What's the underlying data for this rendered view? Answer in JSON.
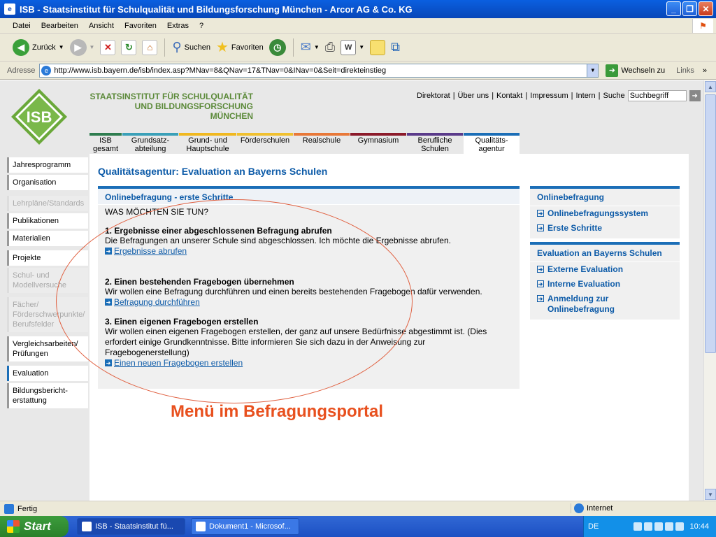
{
  "window": {
    "title": "ISB - Staatsinstitut für Schulqualität und Bildungsforschung München - Arcor AG & Co. KG"
  },
  "menu": [
    "Datei",
    "Bearbeiten",
    "Ansicht",
    "Favoriten",
    "Extras",
    "?"
  ],
  "toolbar": {
    "back": "Zurück",
    "search": "Suchen",
    "favorites": "Favoriten"
  },
  "address": {
    "label": "Adresse",
    "url": "http://www.isb.bayern.de/isb/index.asp?MNav=8&QNav=17&TNav=0&INav=0&Seit=direkteinstieg",
    "go": "Wechseln zu",
    "links": "Links"
  },
  "site": {
    "logo_text": "ISB",
    "org_line1": "STAATSINSTITUT FÜR SCHULQUALITÄT",
    "org_line2": "UND BILDUNGSFORSCHUNG",
    "org_line3": "MÜNCHEN",
    "topnav": [
      "Direktorat",
      "Über uns",
      "Kontakt",
      "Impressum",
      "Intern",
      "Suche"
    ],
    "search_placeholder": "Suchbegriff",
    "tabs": [
      {
        "l1": "ISB",
        "l2": "gesamt",
        "color": "#2e7d4f"
      },
      {
        "l1": "Grundsatz-",
        "l2": "abteilung",
        "color": "#3aa0b8"
      },
      {
        "l1": "Grund- und",
        "l2": "Hauptschule",
        "color": "#f0b820"
      },
      {
        "l1": "Förderschulen",
        "l2": "",
        "color": "#f0c030"
      },
      {
        "l1": "Realschule",
        "l2": "",
        "color": "#e87838"
      },
      {
        "l1": "Gymnasium",
        "l2": "",
        "color": "#8c1a2a"
      },
      {
        "l1": "Berufliche",
        "l2": "Schulen",
        "color": "#5a3a8a"
      },
      {
        "l1": "Qualitäts-",
        "l2": "agentur",
        "color": "#1b6eb7"
      }
    ],
    "sidebar": [
      {
        "label": "Jahresprogramm",
        "state": "normal"
      },
      {
        "label": "Organisation",
        "state": "normal"
      },
      {
        "label": "Lehrpläne/Standards",
        "state": "disabled"
      },
      {
        "label": "Publikationen",
        "state": "normal"
      },
      {
        "label": "Materialien",
        "state": "normal"
      },
      {
        "label": "Projekte",
        "state": "normal"
      },
      {
        "label": "Schul- und Modellversuche",
        "state": "disabled"
      },
      {
        "label": "Fächer/ Förderschwerpunkte/ Berufsfelder",
        "state": "disabled"
      },
      {
        "label": "Vergleichsarbeiten/ Prüfungen",
        "state": "normal"
      },
      {
        "label": "Evaluation",
        "state": "selected"
      },
      {
        "label": "Bildungsbericht-erstattung",
        "state": "normal"
      }
    ],
    "page_title": "Qualitätsagentur: Evaluation an Bayerns Schulen",
    "main": {
      "heading": "Onlinebefragung - erste Schritte",
      "question": "WAS MÖCHTEN SIE TUN?",
      "s1": {
        "title": "1. Ergebnisse einer abgeschlossenen Befragung abrufen",
        "text": "Die Befragungen an unserer Schule sind abgeschlossen. Ich möchte die Ergebnisse abrufen.",
        "link": "Ergebnisse abrufen"
      },
      "s2": {
        "title": "2. Einen bestehenden Fragebogen übernehmen",
        "text": "Wir wollen eine Befragung durchführen und einen bereits bestehenden Fragebogen dafür verwenden.",
        "link": "Befragung durchführen"
      },
      "s3": {
        "title": "3. Einen eigenen Fragebogen erstellen",
        "text": "Wir wollen einen eigenen Fragebogen erstellen, der ganz auf unsere Bedürfnisse abgestimmt ist. (Dies erfordert einige Grundkenntnisse. Bitte informieren Sie sich dazu in der Anweisung zur Fragebogenerstellung)",
        "link": "Einen neuen Fragebogen erstellen"
      }
    },
    "right1": {
      "heading": "Onlinebefragung",
      "items": [
        "Onlinebefragungssystem",
        "Erste Schritte"
      ]
    },
    "right2": {
      "heading": "Evaluation an Bayerns Schulen",
      "items": [
        "Externe Evaluation",
        "Interne Evaluation",
        "Anmeldung zur Onlinebefragung"
      ]
    }
  },
  "annotation": "Menü im Befragungsportal",
  "status": {
    "text": "Fertig",
    "zone": "Internet"
  },
  "taskbar": {
    "start": "Start",
    "tasks": [
      "ISB - Staatsinstitut fü...",
      "Dokument1 - Microsof..."
    ],
    "lang": "DE",
    "clock": "10:44"
  }
}
